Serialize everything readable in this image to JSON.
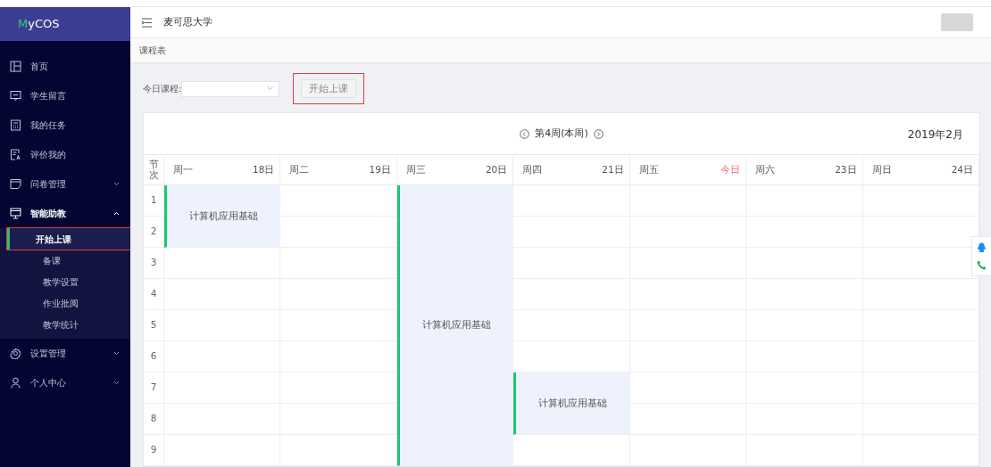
{
  "sidebar": {
    "logo": "MyCOS",
    "items": [
      {
        "label": "首页",
        "expandable": false,
        "expanded": false
      },
      {
        "label": "学生留言",
        "expandable": false,
        "expanded": false
      },
      {
        "label": "我的任务",
        "expandable": false,
        "expanded": false
      },
      {
        "label": "评价我的",
        "expandable": false,
        "expanded": false
      },
      {
        "label": "问卷管理",
        "expandable": true,
        "expanded": false
      },
      {
        "label": "智能助教",
        "expandable": true,
        "expanded": true,
        "children": [
          {
            "label": "开始上课",
            "selected": true,
            "highlighted": true
          },
          {
            "label": "备课",
            "selected": false,
            "highlighted": false
          },
          {
            "label": "教学设置",
            "selected": false,
            "highlighted": false
          },
          {
            "label": "作业批阅",
            "selected": false,
            "highlighted": false
          },
          {
            "label": "教学统计",
            "selected": false,
            "highlighted": false
          }
        ]
      },
      {
        "label": "设置管理",
        "expandable": true,
        "expanded": false
      },
      {
        "label": "个人中心",
        "expandable": true,
        "expanded": false
      }
    ]
  },
  "header": {
    "title": "麦可思大学"
  },
  "breadcrumb": "课程表",
  "toolbar": {
    "label": "今日课程:",
    "button": {
      "label": "开始上课",
      "disabled": true,
      "highlighted": true
    }
  },
  "calendar": {
    "week_label": "第4周(本周)",
    "month": "2019年2月",
    "period_header": "节次",
    "days": [
      {
        "name": "周一",
        "date": "18日",
        "today": false,
        "events": [
          {
            "title": "计算机应用基础"
          }
        ]
      },
      {
        "name": "周二",
        "date": "19日",
        "today": false
      },
      {
        "name": "周三",
        "date": "20日",
        "today": false,
        "events": [
          {
            "title": "计算机应用基础"
          }
        ]
      },
      {
        "name": "周四",
        "date": "21日",
        "today": false,
        "events": [
          {
            "title": "计算机应用基础"
          }
        ]
      },
      {
        "name": "周五",
        "date": "今日",
        "today": true
      },
      {
        "name": "周六",
        "date": "23日",
        "today": false
      },
      {
        "name": "周日",
        "date": "24日",
        "today": false
      }
    ],
    "periods": [
      "1",
      "2",
      "3",
      "4",
      "5",
      "6",
      "7",
      "8",
      "9"
    ]
  }
}
